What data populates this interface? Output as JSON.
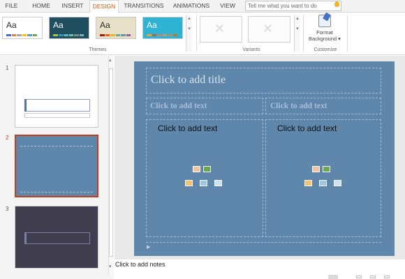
{
  "ribbon_tabs": [
    {
      "label": "FILE",
      "active": false
    },
    {
      "label": "HOME",
      "active": false
    },
    {
      "label": "INSERT",
      "active": false
    },
    {
      "label": "DESIGN",
      "active": true
    },
    {
      "label": "TRANSITIONS",
      "active": false
    },
    {
      "label": "ANIMATIONS",
      "active": false
    },
    {
      "label": "VIEW",
      "active": false
    }
  ],
  "search": {
    "placeholder": "Tell me what you want to do"
  },
  "themes": {
    "group_label": "Themes",
    "items": [
      {
        "text": "Aa",
        "bg": "#ffffff",
        "fg": "#2b2b2b",
        "colors": [
          "#4472c4",
          "#ed7d31",
          "#a5a5a5",
          "#ffc000",
          "#5b9bd5",
          "#70ad47"
        ]
      },
      {
        "text": "Aa",
        "bg": "#1f4e5f",
        "fg": "#ffffff",
        "colors": [
          "#a5c249",
          "#3494ba",
          "#58b6c0",
          "#75bda7",
          "#7a8c8e",
          "#84acb6"
        ]
      },
      {
        "text": "Aa",
        "bg": "#e8dfc9",
        "fg": "#2b2b2b",
        "colors": [
          "#b01513",
          "#ea6312",
          "#e6b729",
          "#6aac90",
          "#5f9c9d",
          "#9e5e9b"
        ]
      },
      {
        "text": "Aa",
        "bg": "#2fb3d5",
        "fg": "#ffffff",
        "colors": [
          "#f0a22e",
          "#a5644e",
          "#b58b80",
          "#c3986d",
          "#a19574",
          "#c17529"
        ]
      }
    ]
  },
  "variants": {
    "group_label": "Variants"
  },
  "customize": {
    "group_label": "Customize",
    "format_background_label": "Format Background",
    "format_background_caret": "▾"
  },
  "slides": [
    {
      "number": "1",
      "selected": false,
      "bg": "#ffffff"
    },
    {
      "number": "2",
      "selected": true,
      "bg": "#5f86ab"
    },
    {
      "number": "3",
      "selected": false,
      "bg": "#3f3d4e"
    }
  ],
  "slide": {
    "title_placeholder": "Click to add title",
    "left_header_placeholder": "Click to add text",
    "right_header_placeholder": "Click to add text",
    "left_content_placeholder": "Click to add text",
    "right_content_placeholder": "Click to add text",
    "background": "#5f86ab"
  },
  "notes": {
    "placeholder": "Click to add notes"
  },
  "accent": "#c43e1c"
}
